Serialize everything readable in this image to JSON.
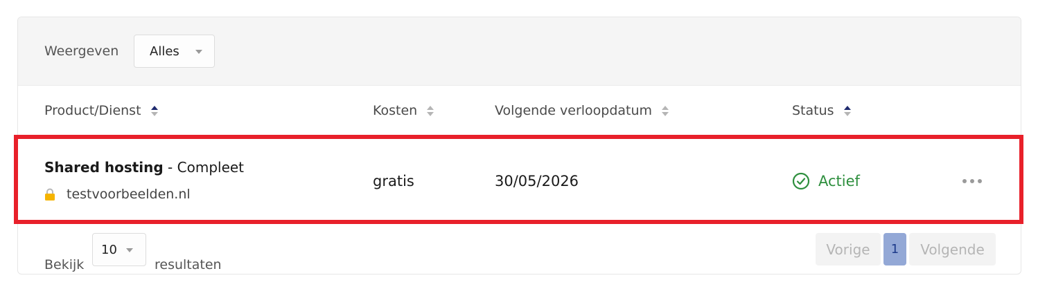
{
  "filter": {
    "label": "Weergeven",
    "selected": "Alles"
  },
  "table": {
    "headers": [
      {
        "label": "Product/Dienst"
      },
      {
        "label": "Kosten"
      },
      {
        "label": "Volgende verloopdatum"
      },
      {
        "label": "Status"
      }
    ],
    "rows": [
      {
        "product_name": "Shared hosting",
        "product_suffix": " - Compleet",
        "domain": "testvoorbeelden.nl",
        "cost": "gratis",
        "expiry_date": "30/05/2026",
        "status": "Actief"
      }
    ]
  },
  "footer": {
    "show_label": "Bekijk",
    "per_page": "10",
    "results_label": "resultaten",
    "pagination": {
      "prev": "Vorige",
      "current_page": "1",
      "next": "Volgende"
    }
  },
  "colors": {
    "status_active": "#2e8f3e",
    "highlight_border": "#e8202a",
    "sort_active": "#1e2a6e",
    "page_active_bg": "#93a8d6"
  },
  "icons": {
    "sort": "sort-icon",
    "lock": "lock-icon",
    "status": "check-circle-icon",
    "more": "more-horizontal-icon",
    "dropdown": "chevron-down-icon"
  }
}
